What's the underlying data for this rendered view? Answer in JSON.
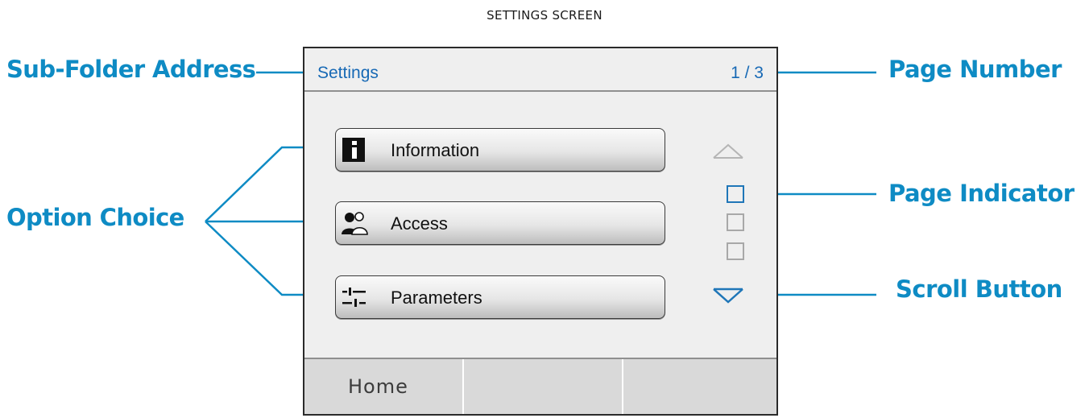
{
  "caption": "SETTINGS SCREEN",
  "callouts": {
    "sub_folder_address": "Sub-Folder Address",
    "option_choice": "Option Choice",
    "page_number": "Page Number",
    "page_indicator": "Page Indicator",
    "scroll_button": "Scroll Button"
  },
  "screen": {
    "header": {
      "title": "Settings",
      "page": "1 / 3"
    },
    "options": [
      {
        "label": "Information",
        "icon": "info-icon"
      },
      {
        "label": "Access",
        "icon": "users-icon"
      },
      {
        "label": "Parameters",
        "icon": "sliders-icon"
      }
    ],
    "pages": {
      "current": 1,
      "total": 3
    },
    "footer": {
      "home_label": "Home"
    }
  },
  "colors": {
    "callout": "#0e8bc4",
    "header_text": "#1769b5",
    "active_indicator": "#1f76b8",
    "inactive_indicator": "#a8a8a8"
  }
}
